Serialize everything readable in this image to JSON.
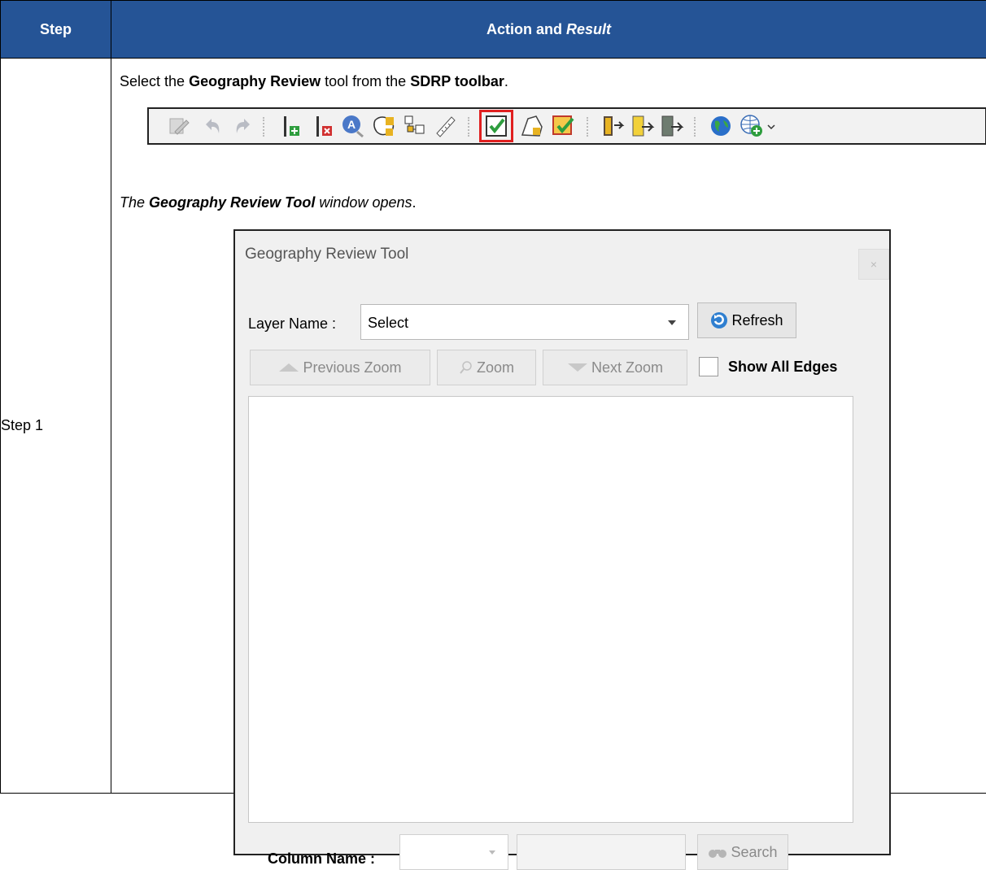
{
  "table": {
    "header_step": "Step",
    "header_action_plain": "Action and ",
    "header_action_italic": "Result",
    "step_label": "Step 1"
  },
  "instruction": {
    "p1": "Select the ",
    "b1": "Geography Review",
    "p2": " tool from the ",
    "b2": "SDRP toolbar",
    "p3": "."
  },
  "result": {
    "p1": "The ",
    "b1": "Geography Review Tool",
    "p2": " window opens",
    "p3": "."
  },
  "toolbar": {
    "icons": [
      "edit-icon",
      "undo-icon",
      "redo-icon",
      "add-node-icon",
      "delete-node-icon",
      "label-icon",
      "geography-icon",
      "split-icon",
      "measure-icon",
      "geography-review-icon",
      "polygon-icon",
      "validate-icon",
      "import-icon",
      "export-icon",
      "transfer-icon",
      "globe-icon",
      "add-globe-icon"
    ],
    "highlight_color": "#e02020"
  },
  "dialog": {
    "title": "Geography Review Tool",
    "close_glyph": "×",
    "layer_name_label": "Layer Name :",
    "layer_select_value": "Select",
    "refresh_label": "Refresh",
    "previous_zoom_label": "Previous Zoom",
    "zoom_label": "Zoom",
    "next_zoom_label": "Next Zoom",
    "show_all_edges_label": "Show All Edges",
    "column_name_label": "Column Name :",
    "search_label": "Search"
  },
  "colors": {
    "header_bg": "#255496"
  }
}
